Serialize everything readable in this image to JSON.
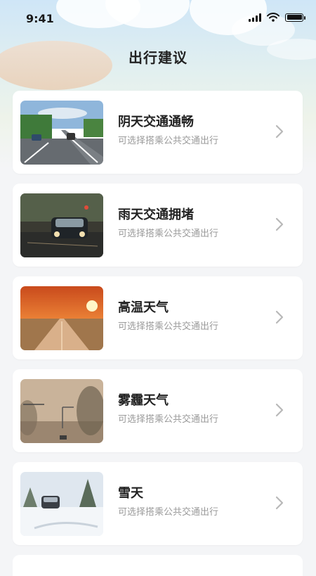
{
  "status_bar": {
    "time": "9:41"
  },
  "header": {
    "title": "出行建议"
  },
  "cards": [
    {
      "title": "阴天交通通畅",
      "subtitle": "可选择搭乘公共交通出行",
      "image": "highway-overcast"
    },
    {
      "title": "雨天交通拥堵",
      "subtitle": "可选择搭乘公共交通出行",
      "image": "rainy-street-car"
    },
    {
      "title": "高温天气",
      "subtitle": "可选择搭乘公共交通出行",
      "image": "hot-sunset-road"
    },
    {
      "title": "雾霾天气",
      "subtitle": "可选择搭乘公共交通出行",
      "image": "smoggy-intersection"
    },
    {
      "title": "雪天",
      "subtitle": "可选择搭乘公共交通出行",
      "image": "snowy-road-car"
    }
  ],
  "icons": {
    "chevron": "chevron-right-icon",
    "signal": "cellular-signal-icon",
    "wifi": "wifi-icon",
    "battery": "battery-icon"
  }
}
